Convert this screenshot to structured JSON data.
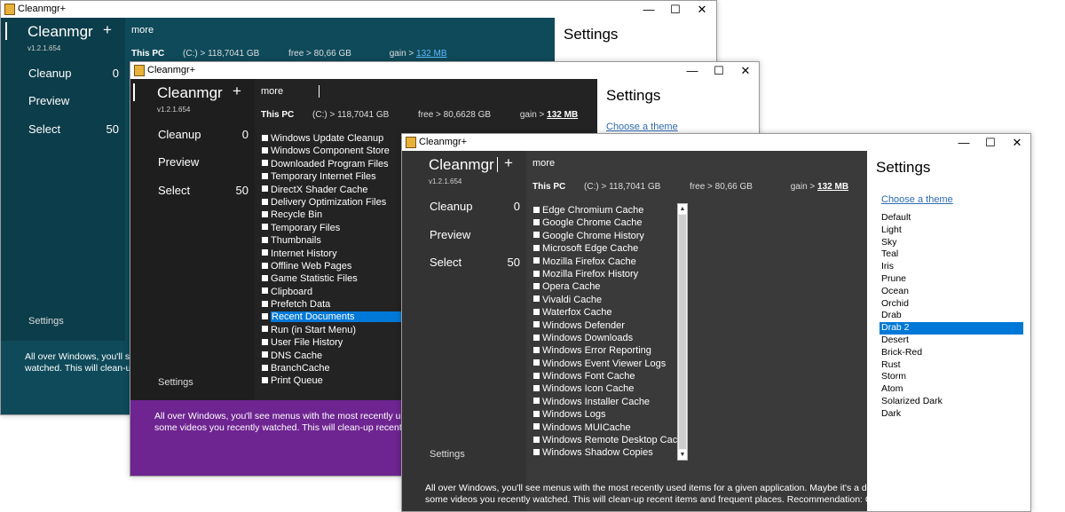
{
  "window1": {
    "title": "Cleanmgr+",
    "app_name": "Cleanmgr",
    "plus": "+",
    "version": "v1.2.1.654",
    "more": "more",
    "nav": {
      "cleanup": "Cleanup",
      "cleanup_count": "0",
      "preview": "Preview",
      "select": "Select",
      "select_count": "50",
      "settings": "Settings"
    },
    "status": {
      "drive_label": "This PC",
      "drive": "(C:) > 118,7041 GB",
      "free": "free >  80,66 GB",
      "gain_label": "gain >",
      "gain_value": "132 MB"
    },
    "settings_title": "Settings",
    "description_line1": "All over Windows, you'll see",
    "description_line2": "watched. This will clean-up re"
  },
  "window2": {
    "title": "Cleanmgr+",
    "app_name": "Cleanmgr",
    "plus": "+",
    "version": "v1.2.1.654",
    "more": "more",
    "nav": {
      "cleanup": "Cleanup",
      "cleanup_count": "0",
      "preview": "Preview",
      "select": "Select",
      "select_count": "50",
      "settings": "Settings"
    },
    "status": {
      "drive_label": "This PC",
      "drive": "(C:) > 118,7041 GB",
      "free": "free >  80,6628 GB",
      "gain_label": "gain >",
      "gain_value": "132 MB"
    },
    "settings_title": "Settings",
    "choose_theme": "Choose a theme",
    "items": [
      "Windows Update Cleanup",
      "Windows Component Store",
      "Downloaded Program Files",
      "Temporary Internet Files",
      "DirectX Shader Cache",
      "Delivery Optimization Files",
      "Recycle Bin",
      "Temporary Files",
      "Thumbnails",
      "Internet History",
      "Offline Web Pages",
      "Game Statistic Files",
      "Clipboard",
      "Prefetch Data",
      "Recent Documents",
      "Run (in Start Menu)",
      "User File History",
      "DNS Cache",
      "BranchCache",
      "Print Queue"
    ],
    "selected_item": "Recent Documents",
    "description_line1": "All over Windows, you'll see menus with the most recently used ite",
    "description_line2": "some videos you recently watched. This will clean-up recent items"
  },
  "window3": {
    "title": "Cleanmgr+",
    "app_name": "Cleanmgr",
    "plus": "+",
    "version": "v1.2.1.654",
    "more": "more",
    "nav": {
      "cleanup": "Cleanup",
      "cleanup_count": "0",
      "preview": "Preview",
      "select": "Select",
      "select_count": "50",
      "settings": "Settings"
    },
    "status": {
      "drive_label": "This PC",
      "drive": "(C:) > 118,7041 GB",
      "free": "free >  80,66 GB",
      "gain_label": "gain >",
      "gain_value": "132 MB"
    },
    "items": [
      "Edge Chromium Cache",
      "Google Chrome Cache",
      "Google Chrome History",
      "Microsoft Edge Cache",
      "Mozilla Firefox Cache",
      "Mozilla Firefox History",
      "Opera Cache",
      "Vivaldi Cache",
      "Waterfox Cache",
      "Windows Defender",
      "Windows Downloads",
      "Windows Error Reporting",
      "Windows Event Viewer Logs",
      "Windows Font Cache",
      "Windows Icon Cache",
      "Windows Installer Cache",
      "Windows Logs",
      "Windows MUICache",
      "Windows Remote Desktop Cache",
      "Windows Shadow Copies"
    ],
    "settings_title": "Settings",
    "choose_theme": "Choose a theme",
    "themes": [
      "Default",
      "Light",
      "Sky",
      "Teal",
      "Iris",
      "Prune",
      "Ocean",
      "Orchid",
      "Drab",
      "Drab 2",
      "Desert",
      "Brick-Red",
      "Rust",
      "Storm",
      "Atom",
      "Solarized Dark",
      "Dark"
    ],
    "selected_theme": "Drab 2",
    "description_line1": "All over Windows, you'll see menus with the most recently used items for a given application. Maybe it's a document y",
    "description_line2": "some videos you recently watched. This will clean-up recent items and frequent places. Recommendation: Cleanup"
  },
  "colors": {
    "teal_bg": "#0f4a5a",
    "teal_sidebar": "#0c3d4a",
    "dark_bg": "#232323",
    "dark_sidebar": "#1e1e1e",
    "drab_bg": "#3a3a3a",
    "drab_sidebar": "#333333",
    "purple": "#6e2491",
    "selection": "#0078d7"
  },
  "icons": {
    "app": "app-icon",
    "minimize": "minimize-icon",
    "maximize": "maximize-icon",
    "close": "close-icon",
    "scroll_up": "chevron-up-icon",
    "scroll_down": "chevron-down-icon"
  }
}
